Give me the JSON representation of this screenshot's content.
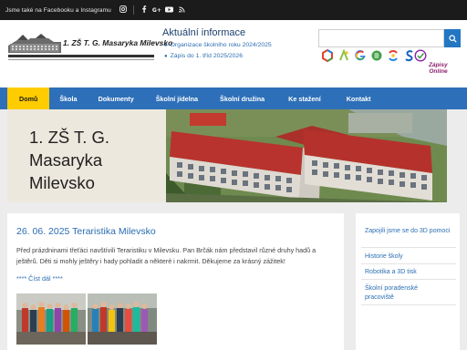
{
  "topbar": {
    "text": "Jsme také na Facebooku a Instagramu",
    "icons": [
      "instagram-icon",
      "facebook-icon",
      "google-plus-icon",
      "youtube-icon",
      "rss-icon"
    ]
  },
  "logo": {
    "text": "1. ZŠ T. G. Masaryka Milevsko"
  },
  "news": {
    "title": "Aktuální informace",
    "items": [
      "Organizace školního roku 2024/2025",
      "Zápis do 1. tříd 2025/2026"
    ]
  },
  "search": {
    "placeholder": "",
    "button_icon": "search-icon"
  },
  "apps": {
    "icons": [
      "office-icon",
      "bakalari-icon",
      "google-icon",
      "edookit-icon",
      "skolaonline-icon",
      "check-icon"
    ],
    "zapisy_line1": "Zápisy",
    "zapisy_line2": "Online"
  },
  "nav": {
    "items": [
      "Domů",
      "Škola",
      "Dokumenty",
      "Školní jídelna",
      "Školní družina",
      "Ke stažení",
      "Kontakt"
    ],
    "active_index": 0
  },
  "banner": {
    "title": "1. ZŠ T. G. Masaryka Milevsko"
  },
  "post": {
    "title": "26. 06. 2025 Teraristika Milevsko",
    "text": "Před prázdninami třeťáci navštívili Teraristiku v Milevsku. Pan Brčák nám představil různé druhy hadů a ještěrů. Děti si mohly ještěry i hady pohladit a některé i nakrmit. Děkujeme za krásný zážitek!",
    "read_more": "**** Číst dál ****"
  },
  "sidebar": {
    "items": [
      "Zapojili jsme se do 3D pomoci",
      "Historie školy",
      "Robotika a 3D tisk",
      "Školní poradenské pracoviště"
    ]
  },
  "colors": {
    "accent": "#2d6fb8",
    "active": "#ffcc00",
    "topbar": "#1b1b1b",
    "link": "#2d6fb3"
  }
}
